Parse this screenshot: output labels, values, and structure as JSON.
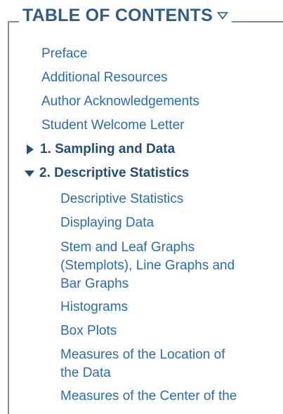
{
  "toc": {
    "title": "TABLE OF CONTENTS",
    "front_matter": [
      "Preface",
      "Additional Resources",
      "Author Acknowledgements",
      "Student Welcome Letter"
    ],
    "chapters": [
      {
        "label": "1. Sampling and Data",
        "expanded": false
      },
      {
        "label": "2. Descriptive Statistics",
        "expanded": true
      }
    ],
    "sections": [
      "Descriptive Statistics",
      "Displaying Data",
      "Stem and Leaf Graphs",
      "(Stemplots), Line Graphs and",
      "Bar Graphs",
      "Histograms",
      "Box Plots",
      "Measures of the Location of",
      "the Data",
      "Measures of the Center of the"
    ]
  },
  "colors": {
    "title": "#2f5d89",
    "link": "#2b6cae",
    "chapter": "#244e78",
    "border": "#7f8c99"
  },
  "icons": {
    "toggle": "triangle-down-outline-icon",
    "collapsed": "triangle-right-icon",
    "expanded": "triangle-down-icon"
  }
}
